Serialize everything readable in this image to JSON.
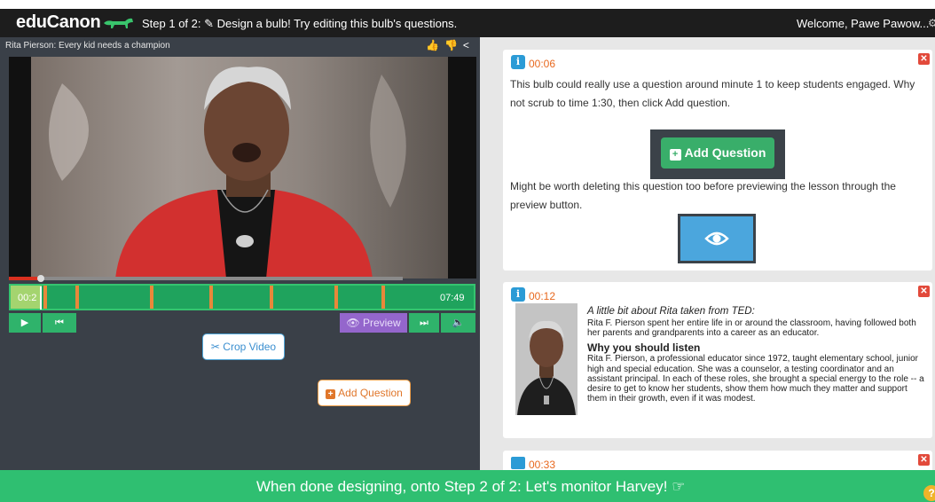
{
  "header": {
    "logo": "eduCanon",
    "step_text": "Step 1 of 2: ✎ Design a bulb! Try editing this bulb's questions.",
    "welcome": "Welcome, Pawe Pawow..."
  },
  "video": {
    "title": "Rita Pierson: Every kid needs a champion",
    "current_time": "00:2",
    "end_time": "07:49",
    "progress_fraction": 0.068,
    "question_markers_fraction": [
      0.02,
      0.07,
      0.14,
      0.3,
      0.43,
      0.56,
      0.7,
      0.8
    ]
  },
  "controls": {
    "play_icon": "play-icon",
    "rewind_icon": "skip-back-icon",
    "preview_label": "Preview",
    "skip_icon": "skip-forward-icon",
    "volume_icon": "volume-icon"
  },
  "buttons": {
    "crop_video": "Crop Video",
    "add_question": "Add Question"
  },
  "questions": [
    {
      "time": "00:06",
      "icon": "info-icon",
      "text_1": "This bulb could really use a question around minute 1 to keep students engaged. Why not scrub to time 1:30, then click Add question.",
      "button_label": "Add Question",
      "text_2": "Might be worth deleting this question too before previewing the lesson through the preview button."
    },
    {
      "time": "00:12",
      "icon": "info-icon",
      "intro": "A little bit about Rita taken from TED:",
      "intro_body": "Rita F. Pierson spent her entire life in or around the classroom, having followed both her parents and grandparents into a career as an educator.",
      "heading": "Why you should listen",
      "body": "Rita F. Pierson, a professional educator since 1972, taught elementary school, junior high and special education. She was a counselor, a testing coordinator and an assistant principal. In each of these roles, she brought a special energy to the role -- a desire to get to know her students, show them how much they matter and support them in their growth, even if it was modest."
    },
    {
      "time": "00:33",
      "icon": "keyboard-icon"
    }
  ],
  "footer": {
    "text": "When done designing, onto Step 2 of 2: Let's monitor Harvey! ☞",
    "help": "?"
  },
  "colors": {
    "green": "#2fbf71",
    "orange": "#e8691f",
    "blue": "#2b9bd6",
    "purple": "#9466cc",
    "red": "#e24a3b"
  }
}
